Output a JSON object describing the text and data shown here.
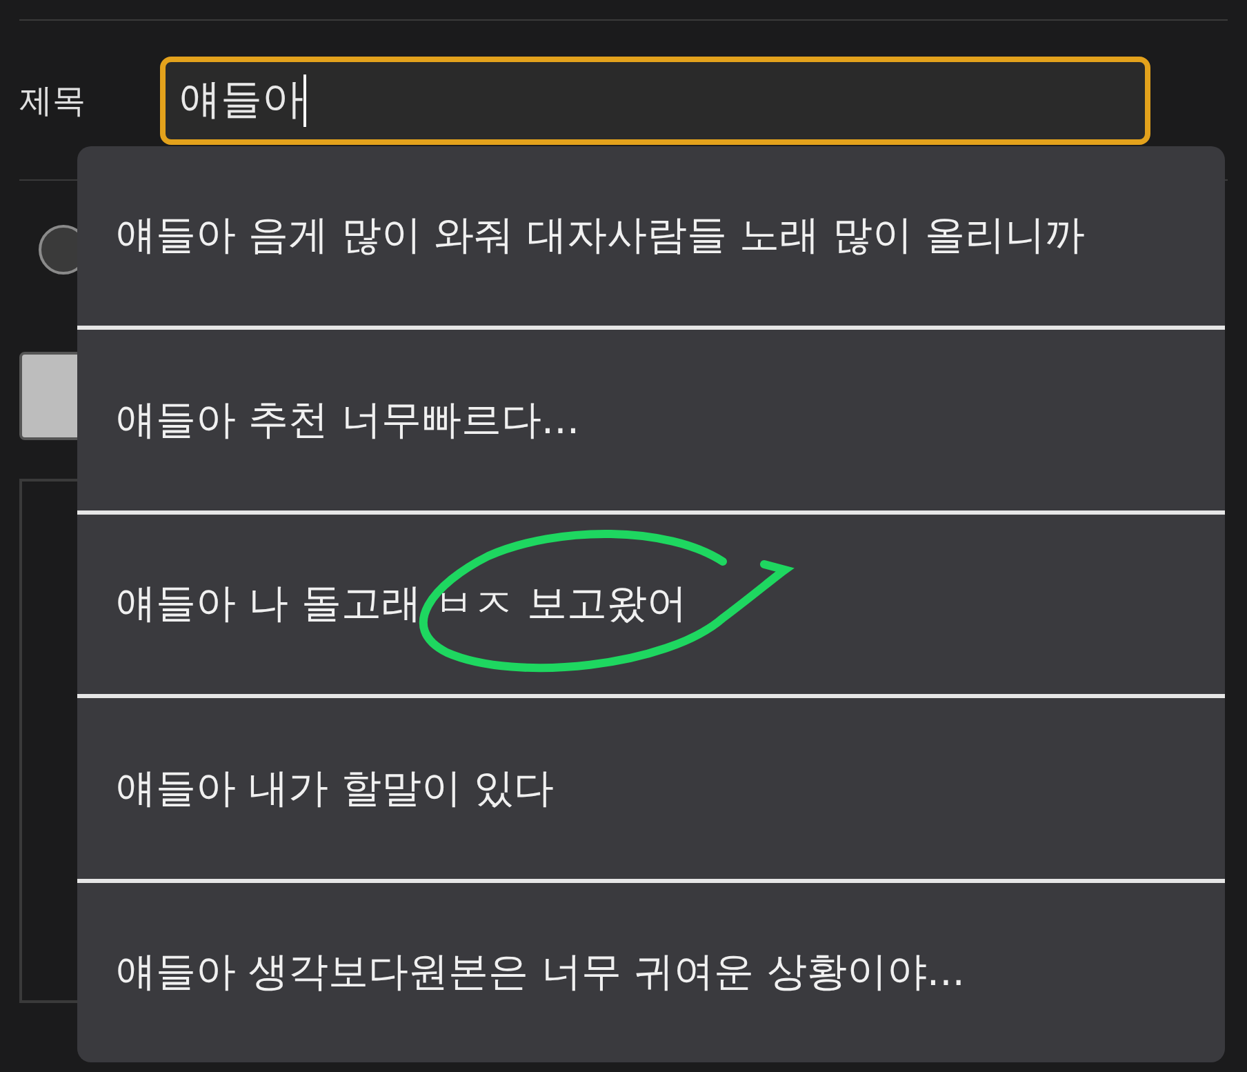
{
  "title_field": {
    "label": "제목",
    "value": "얘들아",
    "focused": true
  },
  "radio": {
    "checked": false
  },
  "suggestions": [
    {
      "text": "얘들아 음게 많이 와줘 대자사람들 노래 많이 올리니까",
      "circled": false
    },
    {
      "text": "얘들아 추천 너무빠르다...",
      "circled": false
    },
    {
      "text": "얘들아 나 돌고래 ㅂㅈ 보고왔어",
      "circled": true
    },
    {
      "text": "얘들아 내가 할말이 있다",
      "circled": false
    },
    {
      "text": "얘들아 생각보다원본은 너무 귀여운 상황이야...",
      "circled": false
    }
  ]
}
